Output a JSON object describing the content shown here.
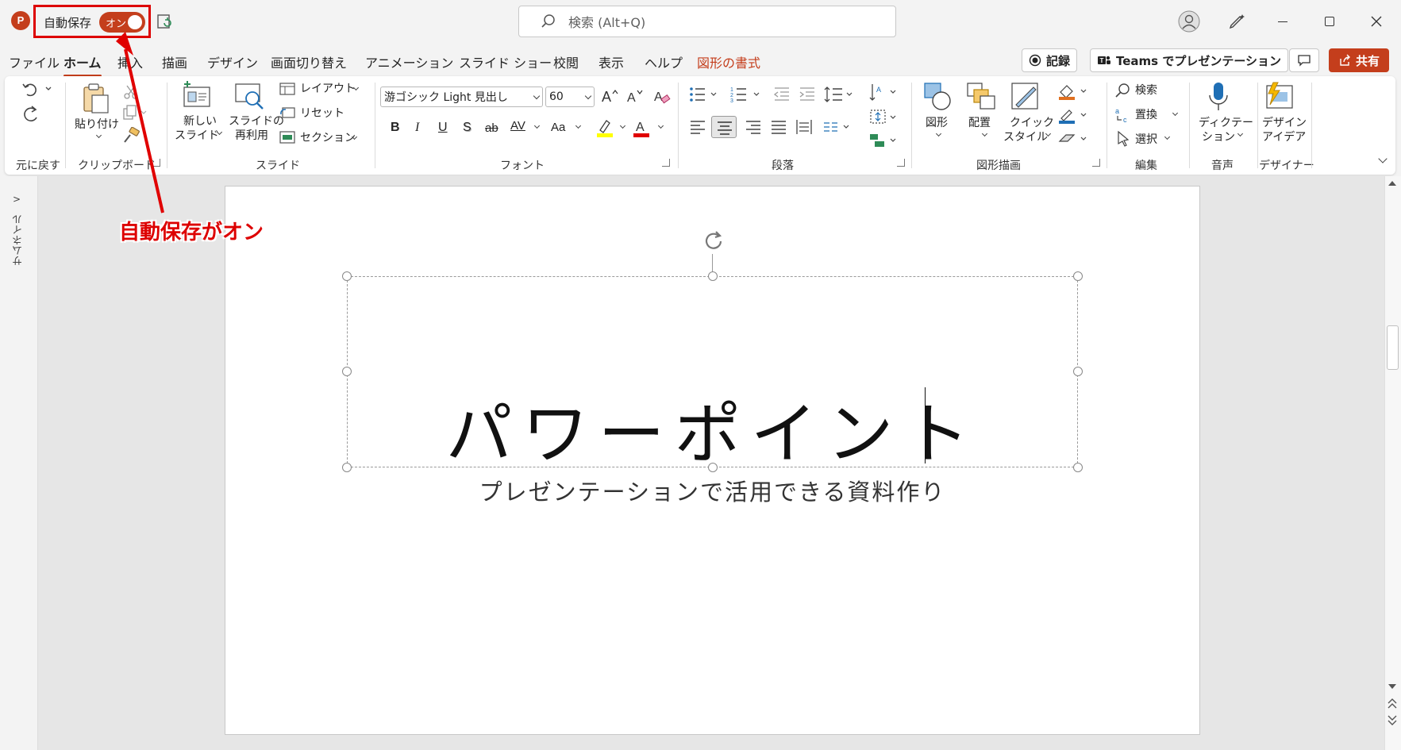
{
  "app": {
    "icon_letter": "P"
  },
  "titlebar": {
    "autosave_label": "自動保存",
    "autosave_state": "オン",
    "search_placeholder": "検索 (Alt+Q)"
  },
  "tabs": [
    {
      "label": "ファイル"
    },
    {
      "label": "ホーム"
    },
    {
      "label": "挿入"
    },
    {
      "label": "描画"
    },
    {
      "label": "デザイン"
    },
    {
      "label": "画面切り替え"
    },
    {
      "label": "アニメーション"
    },
    {
      "label": "スライド ショー"
    },
    {
      "label": "校閲"
    },
    {
      "label": "表示"
    },
    {
      "label": "ヘルプ"
    },
    {
      "label": "図形の書式"
    }
  ],
  "actions": {
    "record": "記録",
    "teams": "Teams でプレゼンテーション",
    "share": "共有"
  },
  "ribbon": {
    "groups": {
      "undo": "元に戻す",
      "clipboard": "クリップボード",
      "slides": "スライド",
      "font": "フォント",
      "paragraph": "段落",
      "drawing": "図形描画",
      "editing": "編集",
      "voice": "音声",
      "designer": "デザイナー"
    },
    "paste": "貼り付け",
    "new_slide_1": "新しい",
    "new_slide_2": "スライド",
    "reuse_1": "スライドの",
    "reuse_2": "再利用",
    "layout": "レイアウト",
    "reset": "リセット",
    "section": "セクション",
    "font_name": "游ゴシック Light 見出し",
    "font_size": "60",
    "bold": "B",
    "italic": "I",
    "underline": "U",
    "shadow": "S",
    "strike": "ab",
    "spacing": "AV",
    "case": "Aa",
    "font_color_letter": "A",
    "shapes": "図形",
    "arrange": "配置",
    "quick_1": "クイック",
    "quick_2": "スタイル",
    "find": "検索",
    "replace": "置換",
    "select": "選択",
    "dictate_1": "ディクテー",
    "dictate_2": "ション",
    "design_1": "デザイン",
    "design_2": "アイデア",
    "highlight_color": "#ffff00",
    "font_color": "#e00000"
  },
  "thumbnail_pane": {
    "label": "サムネイル"
  },
  "slide": {
    "title": "パワーポイント",
    "subtitle": "プレゼンテーションで活用できる資料作り"
  },
  "annotation": {
    "text": "自動保存がオン",
    "color": "#dd0000"
  },
  "accent": "#c43e1c"
}
